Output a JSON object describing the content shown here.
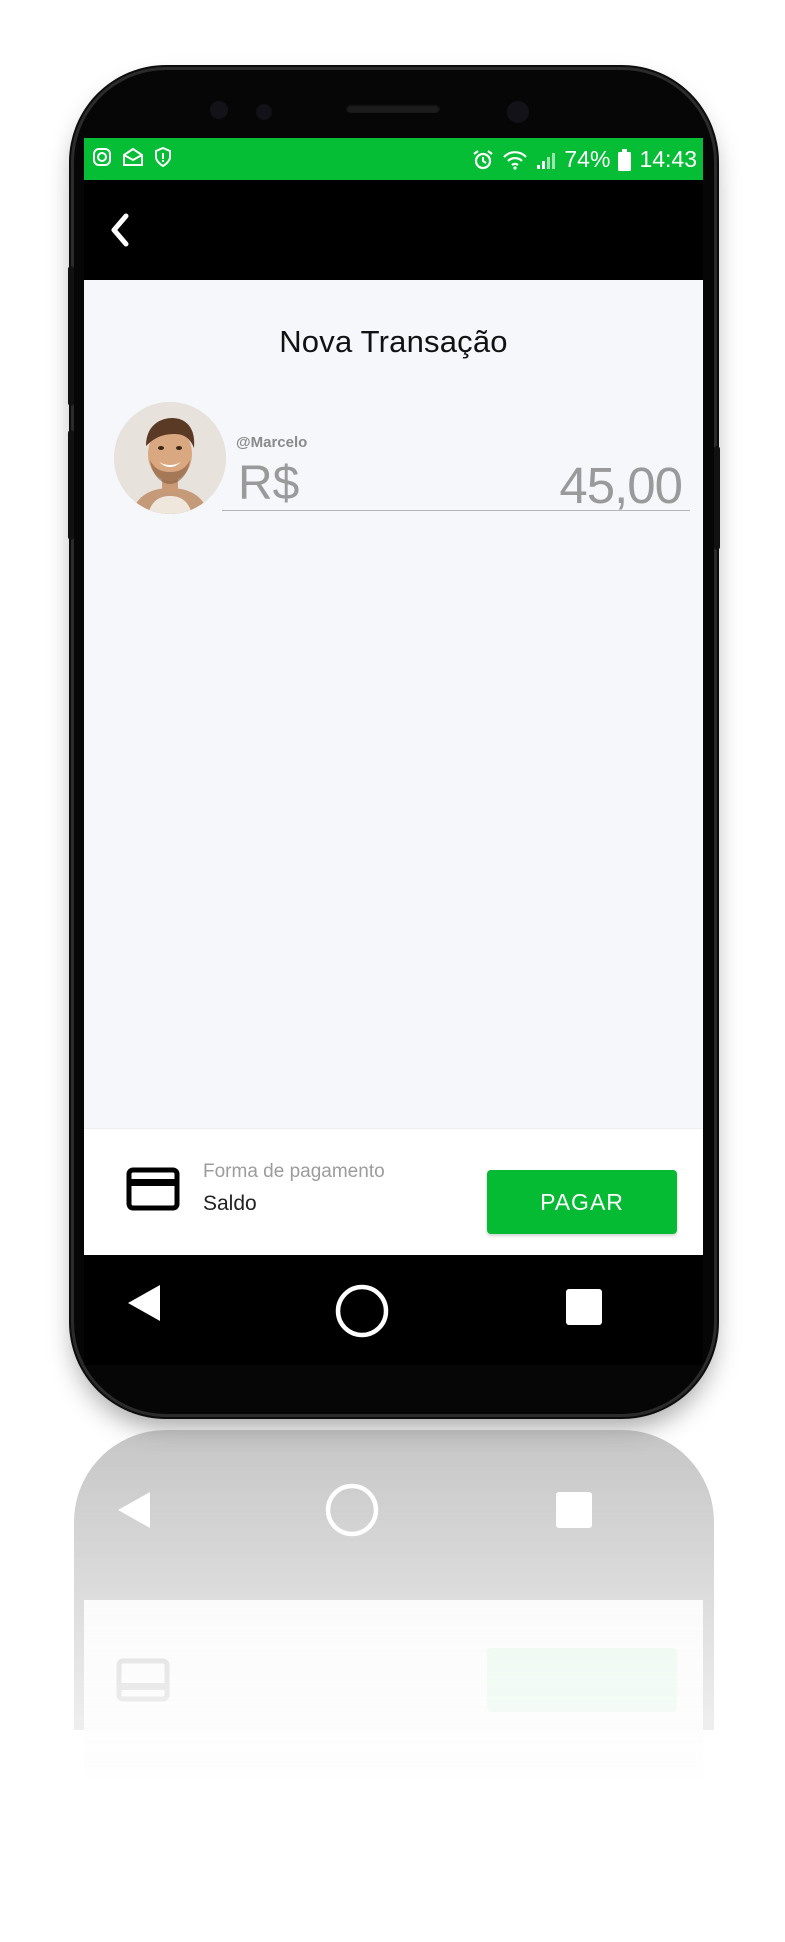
{
  "status_bar": {
    "battery": "74%",
    "time": "14:43",
    "left_icons": [
      "instagram-icon",
      "mail-icon",
      "shield-icon"
    ],
    "right_icons": [
      "alarm-icon",
      "wifi-icon",
      "signal-icon",
      "battery-icon"
    ],
    "color": "#06bd36"
  },
  "header": {
    "back_icon": "chevron-left-icon",
    "title": "Nova Transação"
  },
  "transaction": {
    "recipient": "@Marcelo",
    "currency": "R$",
    "amount": "45,00"
  },
  "payment": {
    "label": "Forma de pagamento",
    "method": "Saldo",
    "icon": "credit-card-icon",
    "pay_button": "PAGAR",
    "accent": "#05bb34"
  },
  "nav_bar": {
    "icons": [
      "nav-back-icon",
      "nav-home-icon",
      "nav-recent-icon"
    ]
  }
}
